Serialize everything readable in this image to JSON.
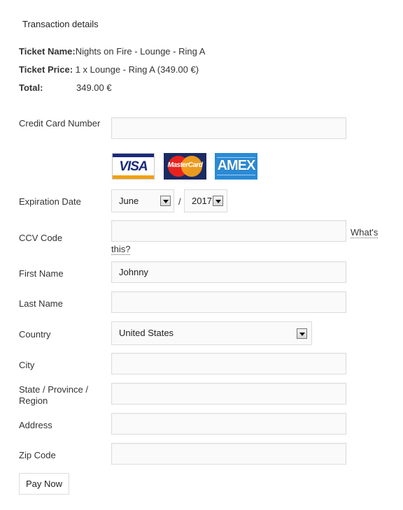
{
  "header": {
    "title": "Transaction details"
  },
  "summary": {
    "ticket_name_label": "Ticket Name:",
    "ticket_name_value": "Nights on Fire - Lounge - Ring A",
    "ticket_price_label": "Ticket Price:",
    "ticket_price_value": "1 x Lounge - Ring A (349.00 €)",
    "total_label": "Total:",
    "total_value": "349.00 €"
  },
  "form": {
    "credit_card": {
      "label": "Credit Card Number",
      "value": ""
    },
    "cards": {
      "visa": "VISA",
      "mastercard": "MasterCard",
      "amex": "AMEX"
    },
    "expiration": {
      "label": "Expiration Date",
      "month": "June",
      "separator": "/",
      "year": "2017"
    },
    "ccv": {
      "label": "CCV Code",
      "value": "",
      "help_part1": "What's",
      "help_part2": "this?"
    },
    "first_name": {
      "label": "First Name",
      "value": "Johnny"
    },
    "last_name": {
      "label": "Last Name",
      "value": ""
    },
    "country": {
      "label": "Country",
      "value": "United States"
    },
    "city": {
      "label": "City",
      "value": ""
    },
    "state": {
      "label_line1": "State / Province /",
      "label_line2": "Region",
      "value": ""
    },
    "address": {
      "label": "Address",
      "value": ""
    },
    "zip": {
      "label": "Zip Code",
      "value": ""
    },
    "submit_label": "Pay Now"
  },
  "icons": {
    "dropdown": "chevron-down-icon"
  }
}
